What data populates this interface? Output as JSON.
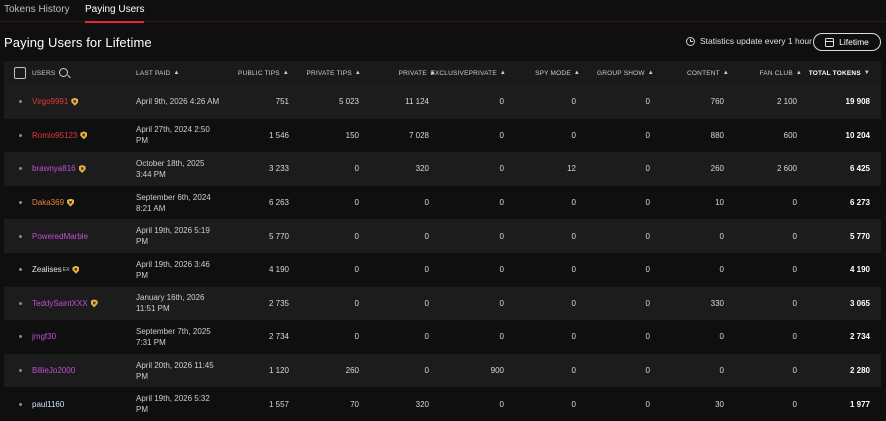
{
  "tabs": [
    {
      "label": "Tokens History",
      "active": false
    },
    {
      "label": "Paying Users",
      "active": true
    }
  ],
  "header": {
    "title": "Paying Users for Lifetime",
    "stats_note": "Statistics update every 1 hour",
    "period_button": "Lifetime"
  },
  "colors": {
    "accent": "#e0283a",
    "red_user": "#e03a3a",
    "purple_user": "#c24fd6",
    "orange_user": "#e8833a",
    "white_user": "#e6e6e6",
    "light_blue_user": "#cfe0ff",
    "badge": "#e8b04a"
  },
  "table": {
    "headers": {
      "users": "USERS",
      "last_paid": "LAST PAID",
      "public_tips": "PUBLIC TIPS",
      "private_tips": "PRIVATE TIPS",
      "private": "PRIVATE",
      "exclusive_private_1": "EXCLUSIVE",
      "exclusive_private_2": "PRIVATE",
      "spy_mode": "SPY MODE",
      "group_show": "GROUP SHOW",
      "content": "CONTENT",
      "fan_club": "FAN CLUB",
      "total_tokens": "TOTAL TOKENS"
    },
    "rows": [
      {
        "user": "Virgo9991",
        "color": "#e03a3a",
        "badge": true,
        "sup": "",
        "last_paid": "April 9th, 2026 4:26 AM",
        "public_tips": "751",
        "private_tips": "5 023",
        "private": "11 124",
        "exclusive_private": "0",
        "spy_mode": "0",
        "group_show": "0",
        "content": "760",
        "fan_club": "2 100",
        "total": "19 908"
      },
      {
        "user": "Romio95123",
        "color": "#e03a3a",
        "badge": true,
        "sup": "",
        "last_paid": "April 27th, 2024 2:50 PM",
        "public_tips": "1 546",
        "private_tips": "150",
        "private": "7 028",
        "exclusive_private": "0",
        "spy_mode": "0",
        "group_show": "0",
        "content": "880",
        "fan_club": "600",
        "total": "10 204"
      },
      {
        "user": "brawnya816",
        "color": "#c24fd6",
        "badge": true,
        "sup": "",
        "last_paid": "October 18th, 2025 3:44 PM",
        "public_tips": "3 233",
        "private_tips": "0",
        "private": "320",
        "exclusive_private": "0",
        "spy_mode": "12",
        "group_show": "0",
        "content": "260",
        "fan_club": "2 600",
        "total": "6 425"
      },
      {
        "user": "Daka369",
        "color": "#e8833a",
        "badge": true,
        "sup": "",
        "last_paid": "September 6th, 2024 8:21 AM",
        "public_tips": "6 263",
        "private_tips": "0",
        "private": "0",
        "exclusive_private": "0",
        "spy_mode": "0",
        "group_show": "0",
        "content": "10",
        "fan_club": "0",
        "total": "6 273"
      },
      {
        "user": "PoweredMarble",
        "color": "#c24fd6",
        "badge": false,
        "sup": "",
        "last_paid": "April 19th, 2026 5:19 PM",
        "public_tips": "5 770",
        "private_tips": "0",
        "private": "0",
        "exclusive_private": "0",
        "spy_mode": "0",
        "group_show": "0",
        "content": "0",
        "fan_club": "0",
        "total": "5 770"
      },
      {
        "user": "Zealises",
        "color": "#e6e6e6",
        "badge": true,
        "sup": "EX",
        "last_paid": "April 19th, 2026 3:46 PM",
        "public_tips": "4 190",
        "private_tips": "0",
        "private": "0",
        "exclusive_private": "0",
        "spy_mode": "0",
        "group_show": "0",
        "content": "0",
        "fan_club": "0",
        "total": "4 190"
      },
      {
        "user": "TeddySaintXXX",
        "color": "#c24fd6",
        "badge": true,
        "sup": "",
        "last_paid": "January 16th, 2026 11:51 PM",
        "public_tips": "2 735",
        "private_tips": "0",
        "private": "0",
        "exclusive_private": "0",
        "spy_mode": "0",
        "group_show": "0",
        "content": "330",
        "fan_club": "0",
        "total": "3 065"
      },
      {
        "user": "jmgf30",
        "color": "#c24fd6",
        "badge": false,
        "sup": "",
        "last_paid": "September 7th, 2025 7:31 PM",
        "public_tips": "2 734",
        "private_tips": "0",
        "private": "0",
        "exclusive_private": "0",
        "spy_mode": "0",
        "group_show": "0",
        "content": "0",
        "fan_club": "0",
        "total": "2 734"
      },
      {
        "user": "BillieJo2000",
        "color": "#c24fd6",
        "badge": false,
        "sup": "",
        "last_paid": "April 20th, 2026 11:45 PM",
        "public_tips": "1 120",
        "private_tips": "260",
        "private": "0",
        "exclusive_private": "900",
        "spy_mode": "0",
        "group_show": "0",
        "content": "0",
        "fan_club": "0",
        "total": "2 280"
      },
      {
        "user": "paul1160",
        "color": "#cfe0ff",
        "badge": false,
        "sup": "",
        "last_paid": "April 19th, 2026 5:32 PM",
        "public_tips": "1 557",
        "private_tips": "70",
        "private": "320",
        "exclusive_private": "0",
        "spy_mode": "0",
        "group_show": "0",
        "content": "30",
        "fan_club": "0",
        "total": "1 977"
      }
    ]
  }
}
